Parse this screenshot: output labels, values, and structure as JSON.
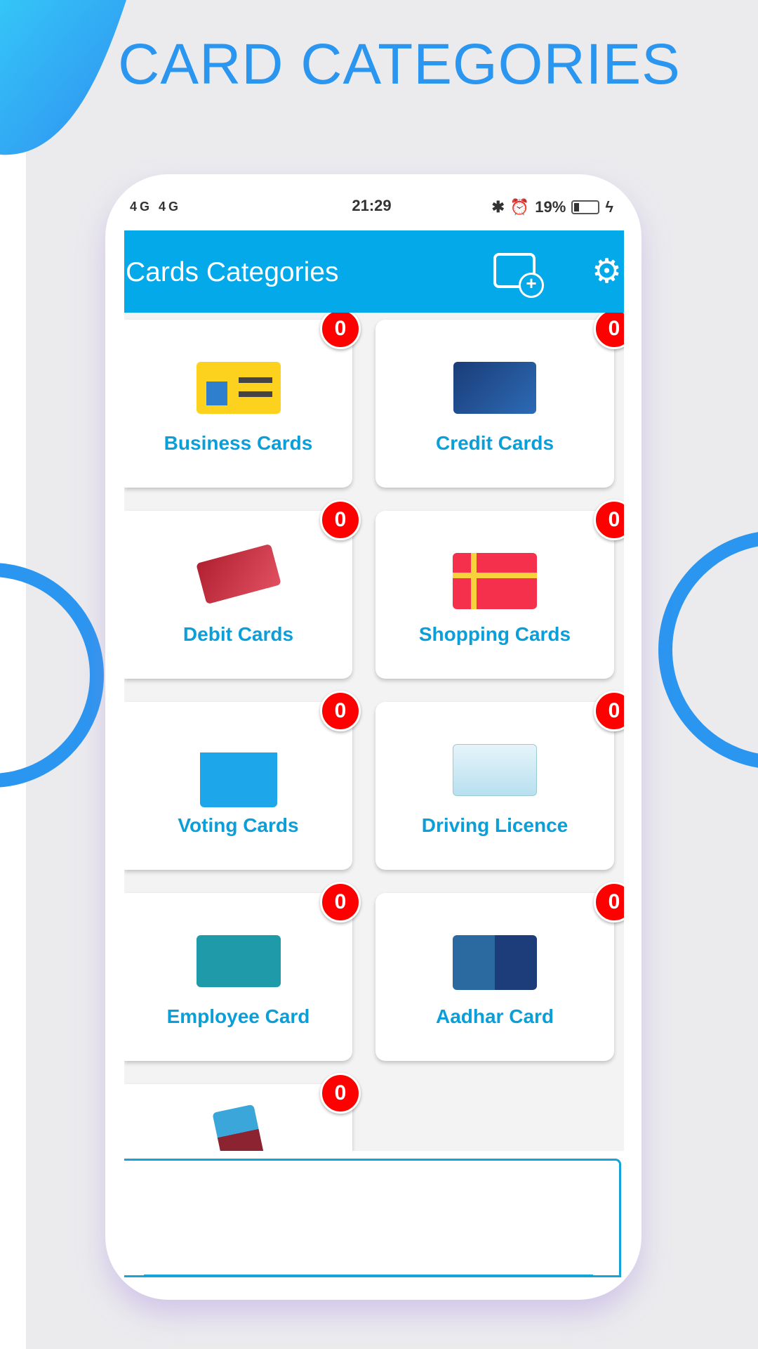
{
  "headline": "CARD CATEGORIES",
  "status": {
    "left_icons": "4G 4G",
    "time": "21:29",
    "battery": "19%"
  },
  "appbar": {
    "title": "Cards Categories",
    "add_icon": "add-contact-card-icon",
    "settings_icon": "gear-icon"
  },
  "colors": {
    "accent": "#03a9e8",
    "badge": "#ff0000",
    "headline": "#2b96f0"
  },
  "categories": [
    {
      "name": "Business Cards",
      "count": "0",
      "icon": "business-card-icon"
    },
    {
      "name": "Credit Cards",
      "count": "0",
      "icon": "credit-card-icon"
    },
    {
      "name": "Debit Cards",
      "count": "0",
      "icon": "debit-card-icon"
    },
    {
      "name": "Shopping Cards",
      "count": "0",
      "icon": "gift-card-icon"
    },
    {
      "name": "Voting Cards",
      "count": "0",
      "icon": "ballot-box-icon"
    },
    {
      "name": "Driving Licence",
      "count": "0",
      "icon": "driving-license-icon"
    },
    {
      "name": "Employee Card",
      "count": "0",
      "icon": "employee-id-icon"
    },
    {
      "name": "Aadhar Card",
      "count": "0",
      "icon": "aadhar-card-icon"
    },
    {
      "name": "",
      "count": "0",
      "icon": "passport-icon"
    }
  ]
}
